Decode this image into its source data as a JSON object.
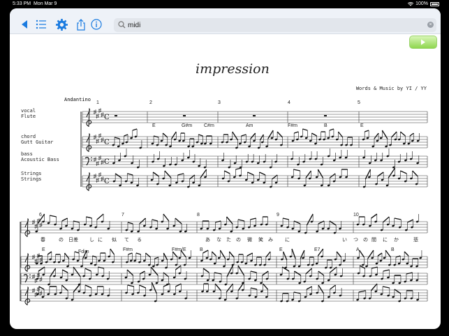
{
  "status": {
    "time": "5:33 PM",
    "date": "Mon Mar 9",
    "battery": "100%"
  },
  "toolbar": {
    "back_icon": "back-triangle-icon",
    "list_icon": "list-icon",
    "settings_icon": "gear-icon",
    "share_icon": "share-icon",
    "info_icon": "info-icon",
    "search_value": "midi",
    "clear_icon": "clear-icon",
    "play_icon": "play-icon"
  },
  "colors": {
    "accent": "#1a7be0",
    "play": "#8fd64f"
  },
  "score": {
    "title": "impression",
    "credit": "Words & Music by YI / YY",
    "tempo": "Andantino",
    "key_signature": "4 sharps",
    "time_signature": "C",
    "instruments": [
      {
        "name": "vocal",
        "program": "Flute"
      },
      {
        "name": "chord",
        "program": "Gutt Guitar"
      },
      {
        "name": "bass",
        "program": "Acoustic Bass"
      },
      {
        "name": "Strings",
        "program": "Strings"
      }
    ],
    "systems": [
      {
        "measures": [
          "1",
          "2",
          "3",
          "4",
          "5"
        ],
        "chords": [
          "E",
          "G#m",
          "C#m",
          "Am",
          "F#m",
          "B",
          "E"
        ]
      },
      {
        "measures": [
          "6",
          "7",
          "8",
          "9",
          "10"
        ],
        "chords": [
          "E",
          "Fdim",
          "F#m",
          "F#m/E",
          "B",
          "E",
          "E7",
          "A",
          "B"
        ],
        "lyrics": [
          "春",
          "の",
          "日差",
          "し",
          "に",
          "似",
          "て",
          "る",
          "あ",
          "な",
          "た",
          "の",
          "微",
          "笑",
          "み",
          "に",
          "い",
          "つ",
          "の",
          "間",
          "に",
          "か",
          "悲"
        ]
      }
    ]
  }
}
